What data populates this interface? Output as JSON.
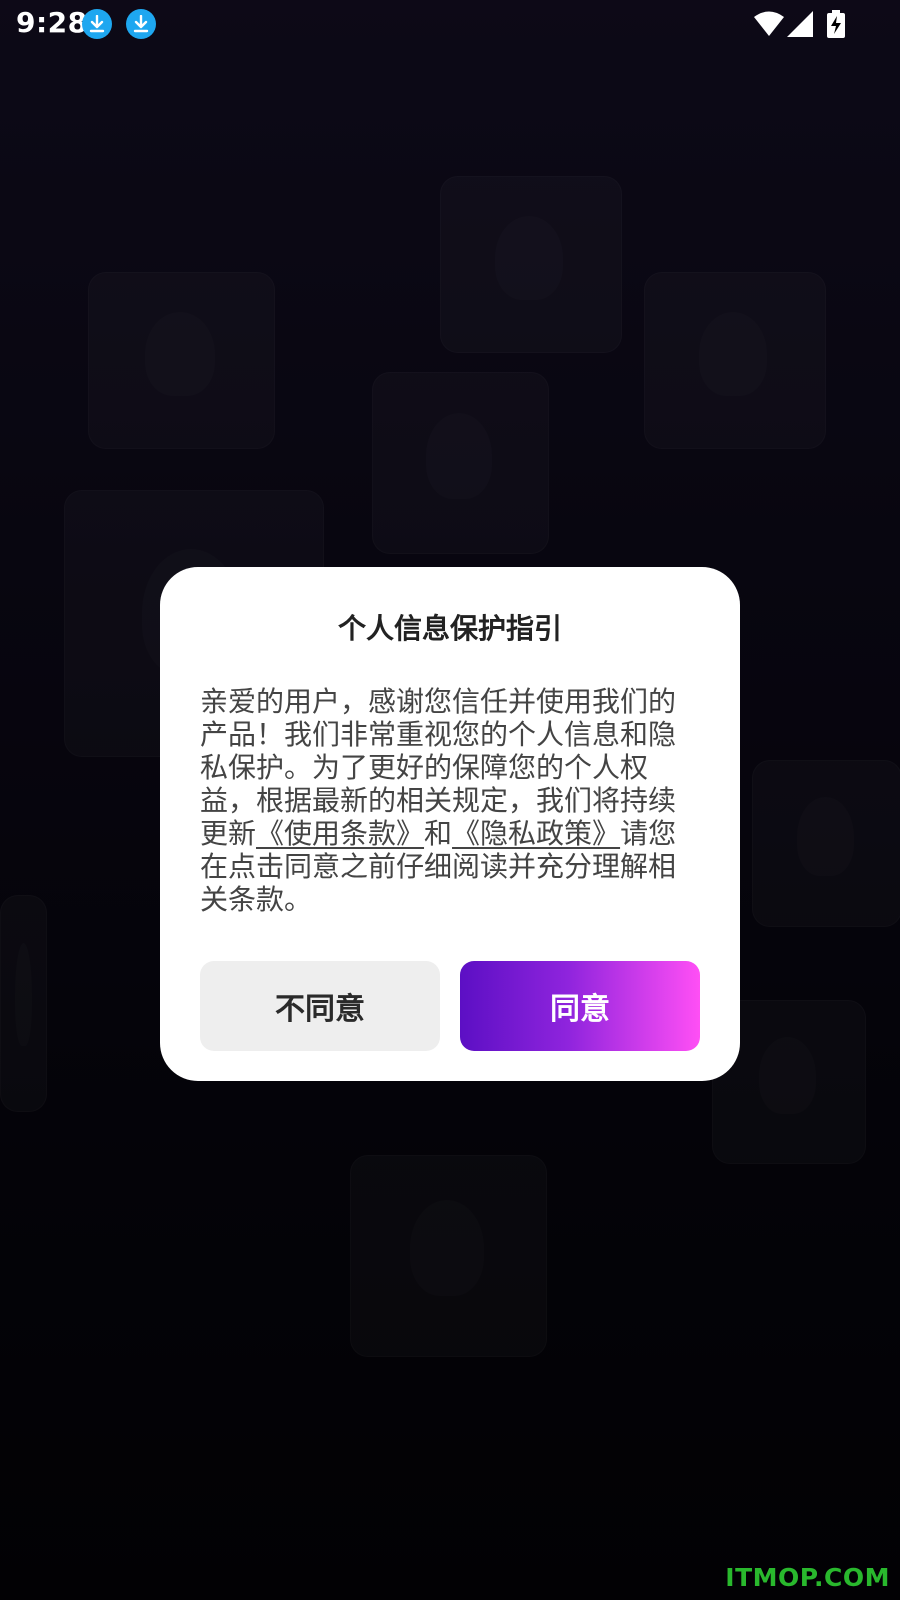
{
  "status_bar": {
    "time": "9:28",
    "notification_icons": [
      "download-icon",
      "download-icon"
    ],
    "system_icons": [
      "wifi-icon",
      "signal-icon",
      "battery-charging-icon"
    ]
  },
  "dialog": {
    "title": "个人信息保护指引",
    "body_part1": "亲爱的用户，感谢您信任并使用我们的产品！我们非常重视您的个人信息和隐私保护。为了更好的保障您的个人权益，根据最新的相关规定，我们将持续更新",
    "terms_link": "《使用条款》",
    "body_and": "和",
    "privacy_link": "《隐私政策》",
    "body_part2": "请您在点击同意之前仔细阅读并充分理解相关条款。",
    "disagree_label": "不同意",
    "agree_label": "同意"
  },
  "colors": {
    "agree_gradient_start": "#5c0fc4",
    "agree_gradient_end": "#ff4ff5",
    "disagree_bg": "#eeeeee",
    "download_icon_bg": "#1ea7f0"
  },
  "watermark": "ITMOP.COM"
}
